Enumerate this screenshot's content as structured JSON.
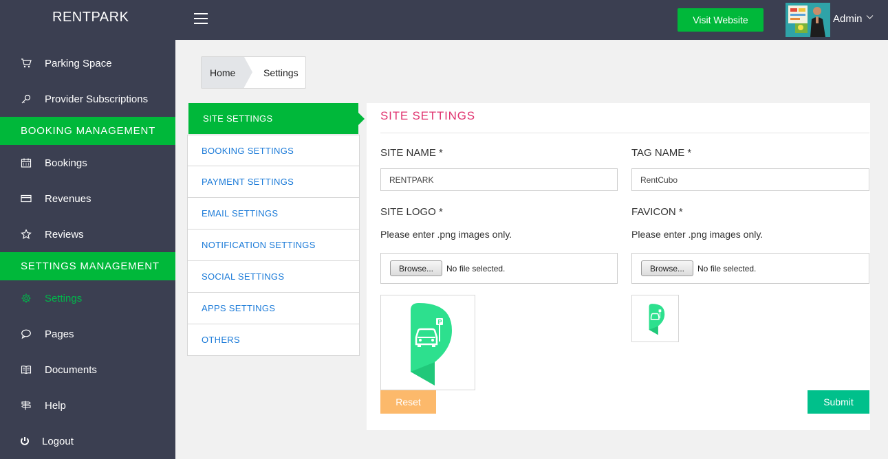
{
  "brand": "RENTPARK",
  "header": {
    "visit_label": "Visit Website",
    "user_name": "Admin"
  },
  "sidebar": {
    "items": [
      {
        "label": "Parking Space",
        "icon": "cart-icon"
      },
      {
        "label": "Provider Subscriptions",
        "icon": "key-icon"
      },
      {
        "section": "BOOKING MANAGEMENT"
      },
      {
        "label": "Bookings",
        "icon": "calendar-icon"
      },
      {
        "label": "Revenues",
        "icon": "credit-card-icon"
      },
      {
        "label": "Reviews",
        "icon": "star-icon"
      },
      {
        "section": "SETTINGS MANAGEMENT"
      },
      {
        "label": "Settings",
        "icon": "gear-icon",
        "active": true
      },
      {
        "label": "Pages",
        "icon": "chat-icon"
      },
      {
        "label": "Documents",
        "icon": "book-icon"
      },
      {
        "label": "Help",
        "icon": "signpost-icon"
      },
      {
        "label": "Logout",
        "icon": "power-icon"
      }
    ]
  },
  "breadcrumb": {
    "home": "Home",
    "current": "Settings"
  },
  "tabs": [
    "SITE SETTINGS",
    "BOOKING SETTINGS",
    "PAYMENT SETTINGS",
    "EMAIL SETTINGS",
    "NOTIFICATION SETTINGS",
    "SOCIAL SETTINGS",
    "APPS SETTINGS",
    "OTHERS"
  ],
  "panel": {
    "title": "SITE SETTINGS",
    "site_name_label": "SITE NAME *",
    "site_name_value": "RENTPARK",
    "tag_name_label": "TAG NAME *",
    "tag_name_value": "RentCubo",
    "site_logo_label": "SITE LOGO *",
    "favicon_label": "FAVICON *",
    "png_hint": "Please enter .png images only.",
    "browse_label": "Browse...",
    "no_file": "No file selected.",
    "reset_label": "Reset",
    "submit_label": "Submit"
  },
  "colors": {
    "sidebar_bg": "#3b3f51",
    "accent_green": "#00b83a",
    "title_pink": "#e0336f",
    "link_blue": "#1a7ad8",
    "reset_orange": "#fcb96b",
    "submit_teal": "#00c08b",
    "logo_green": "#2de08e"
  }
}
